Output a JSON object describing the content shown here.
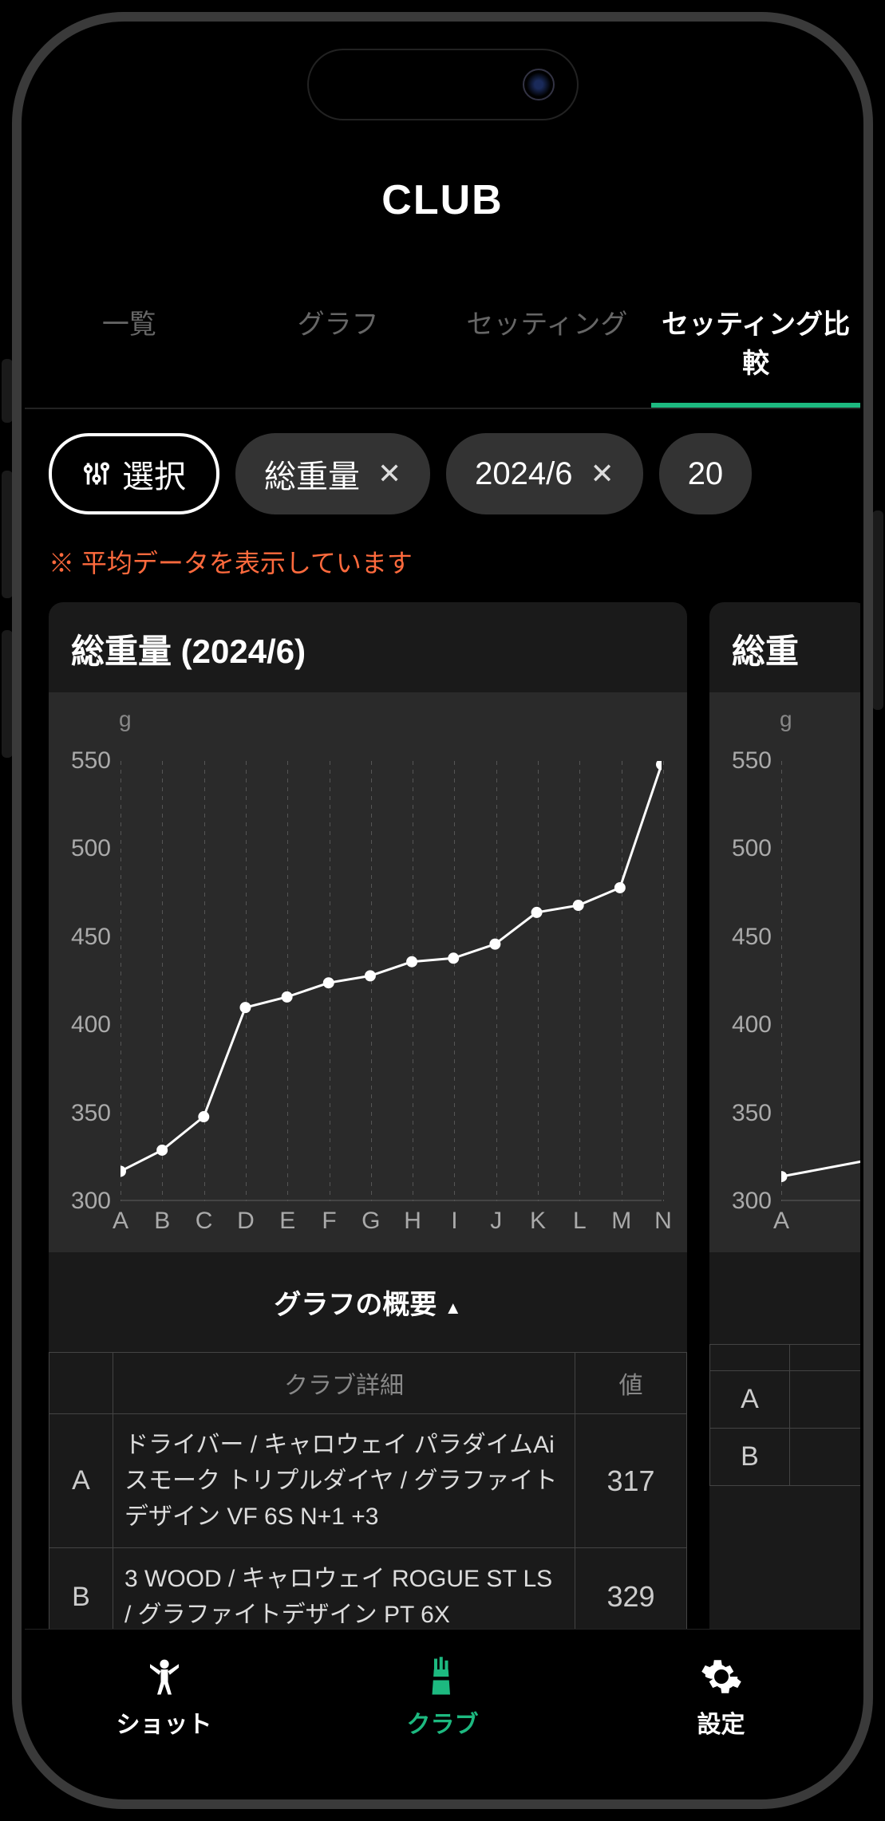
{
  "header": {
    "title": "CLUB"
  },
  "tabs": [
    {
      "label": "一覧"
    },
    {
      "label": "グラフ"
    },
    {
      "label": "セッティング"
    },
    {
      "label": "セッティング比較"
    }
  ],
  "filters": {
    "select_label": "選択",
    "chips": [
      {
        "label": "総重量"
      },
      {
        "label": "2024/6"
      },
      {
        "label": "20"
      }
    ]
  },
  "warning_text": "※ 平均データを表示しています",
  "card_main": {
    "title": "総重量 (2024/6)",
    "y_unit": "g",
    "summary_label": "グラフの概要",
    "th_detail": "クラブ詳細",
    "th_value": "値"
  },
  "card_peek": {
    "title_partial": "総重",
    "y_unit": "g"
  },
  "chart_data": {
    "type": "line",
    "title": "総重量 (2024/6)",
    "ylabel": "g",
    "ylim": [
      300,
      550
    ],
    "yticks": [
      300,
      350,
      400,
      450,
      500,
      550
    ],
    "categories": [
      "A",
      "B",
      "C",
      "D",
      "E",
      "F",
      "G",
      "H",
      "I",
      "J",
      "K",
      "L",
      "M",
      "N"
    ],
    "values": [
      317,
      329,
      348,
      410,
      416,
      424,
      428,
      436,
      438,
      446,
      464,
      468,
      478,
      548
    ]
  },
  "chart_data_peek": {
    "yticks": [
      300,
      350,
      400,
      450,
      500,
      550
    ],
    "categories_partial": [
      "A"
    ],
    "first_value": 314
  },
  "table_rows": [
    {
      "letter": "A",
      "desc": "ドライバー / キャロウェイ パラダイムAiスモーク トリプルダイヤ / グラファイトデザイン VF 6S N+1 +3",
      "value": "317"
    },
    {
      "letter": "B",
      "desc": "3 WOOD / キャロウェイ ROGUE ST LS / グラファイトデザイン PT 6X",
      "value": "329"
    }
  ],
  "peek_rows": [
    {
      "letter": "A"
    },
    {
      "letter": "B"
    }
  ],
  "bottom_nav": [
    {
      "label": "ショット"
    },
    {
      "label": "クラブ"
    },
    {
      "label": "設定"
    }
  ]
}
